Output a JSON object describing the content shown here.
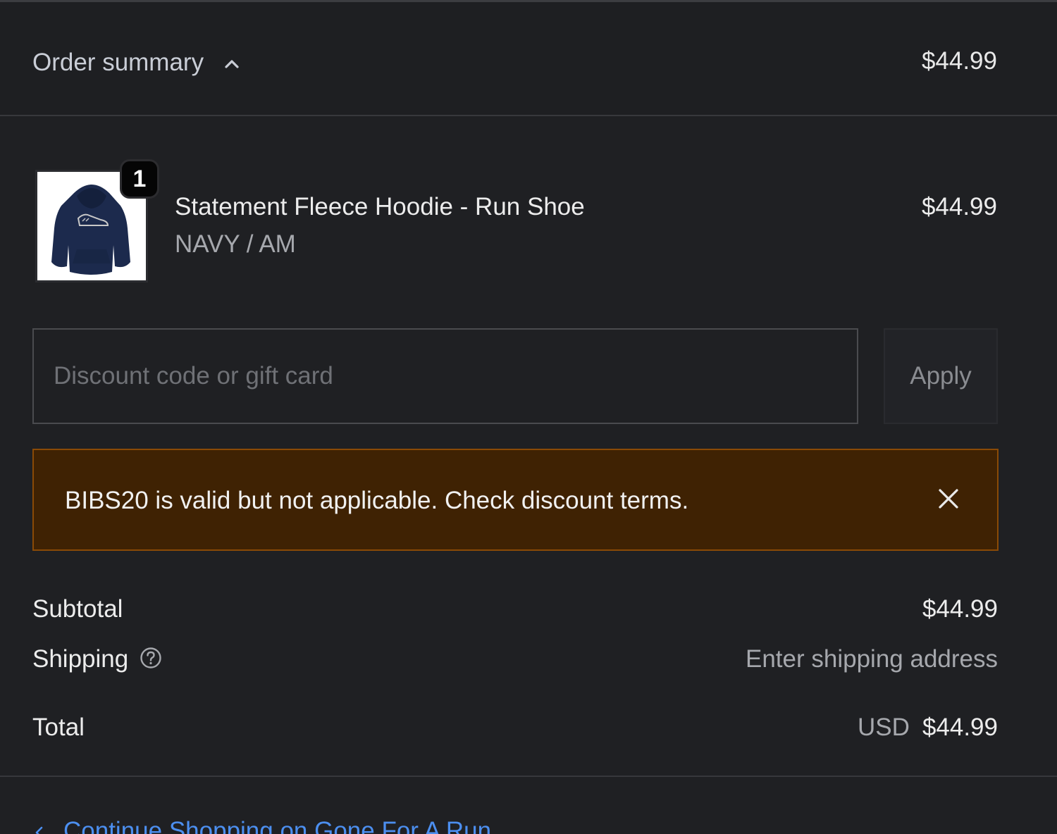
{
  "header": {
    "toggle_label": "Order summary",
    "total": "$44.99"
  },
  "product": {
    "quantity": "1",
    "title": "Statement Fleece Hoodie - Run Shoe",
    "variant": "NAVY / AM",
    "price": "$44.99",
    "image_icon": "hoodie-icon"
  },
  "discount": {
    "placeholder": "Discount code or gift card",
    "value": "",
    "apply_label": "Apply"
  },
  "warning": {
    "message": "BIBS20 is valid but not applicable. Check discount terms."
  },
  "totals": {
    "subtotal_label": "Subtotal",
    "subtotal_value": "$44.99",
    "shipping_label": "Shipping",
    "shipping_value": "Enter shipping address",
    "total_label": "Total",
    "currency": "USD",
    "total_value": "$44.99"
  },
  "footer": {
    "continue_label": "Continue Shopping on Gone For A Run"
  },
  "colors": {
    "background": "#1f2023",
    "warning_bg": "#3f2203",
    "warning_border": "#8a4a06",
    "link": "#4c8ff0"
  }
}
